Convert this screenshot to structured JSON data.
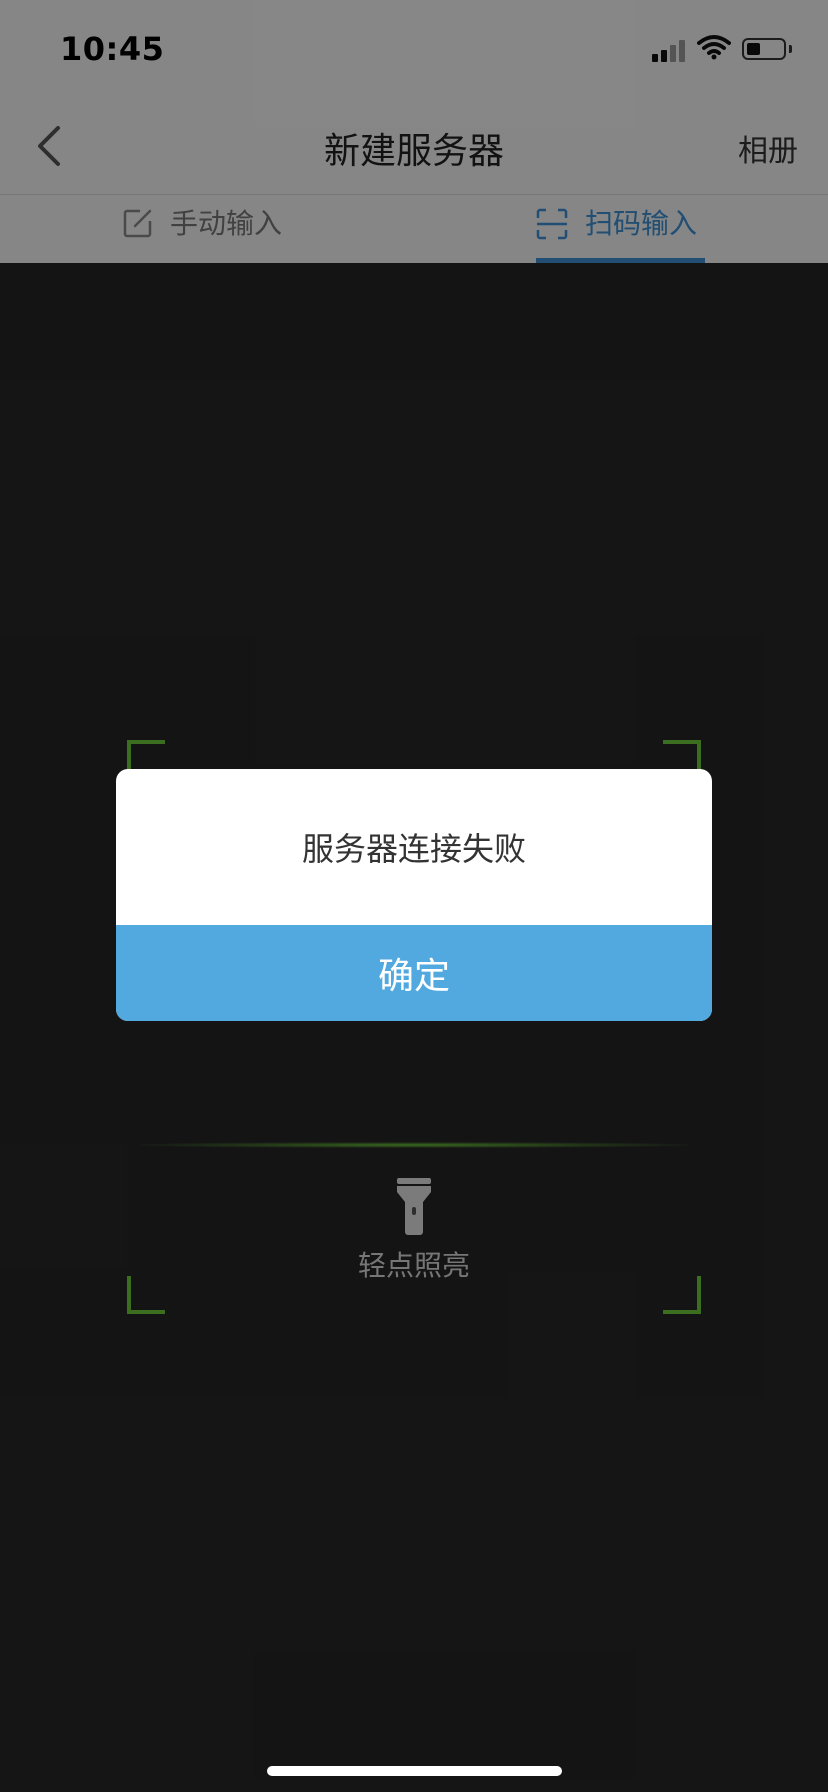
{
  "status_bar": {
    "time": "10:45"
  },
  "nav": {
    "title": "新建服务器",
    "album_label": "相册"
  },
  "tabs": [
    {
      "label": "手动输入",
      "active": false
    },
    {
      "label": "扫码输入",
      "active": true
    }
  ],
  "scanner": {
    "torch_label": "轻点照亮"
  },
  "dialog": {
    "message": "服务器连接失败",
    "confirm_label": "确定"
  },
  "colors": {
    "accent": "#3d8fd0",
    "dialog_button": "#52a9e0",
    "scan_frame": "#6ccb3a"
  }
}
